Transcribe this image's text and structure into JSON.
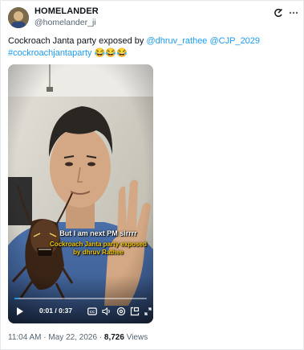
{
  "author": {
    "display_name": "HOMELANDER",
    "handle": "@homelander_ji",
    "avatar_icon": "avatar-image"
  },
  "header_icons": {
    "grok": "grok-icon",
    "more": "more-options-icon"
  },
  "tweet": {
    "text_prefix": "Cockroach Janta party exposed by ",
    "mention_1": "@dhruv_rathee",
    "mention_2": "@CJP_2029",
    "hashtag": "#cockroachjantaparty",
    "emojis": "😂😂😂"
  },
  "video": {
    "caption_white": "But I am next PM sirrrr",
    "caption_yellow": "Cockroach Janta party exposed by dhruv Rathee",
    "time_display": "0:01 / 0:37",
    "progress_fraction": 0.03,
    "controls": [
      "play-icon",
      "captions-icon",
      "volume-icon",
      "settings-icon",
      "picture-in-picture-icon",
      "fullscreen-icon"
    ]
  },
  "meta": {
    "time": "11:04 AM",
    "separator": " · ",
    "date": "May 22, 2026",
    "views_count": "8,726",
    "views_label": " Views"
  },
  "colors": {
    "link": "#1d9bf0",
    "text": "#0f1419",
    "muted": "#536471",
    "caption_yellow": "#f5c800"
  }
}
